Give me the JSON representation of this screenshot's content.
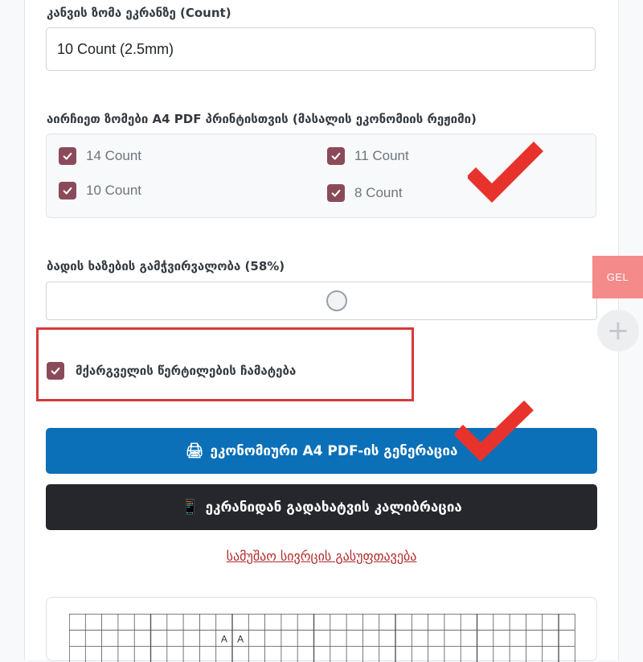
{
  "canvas_size": {
    "label": "კანვის ზომა ეკრანზე (Count)",
    "value": "10 Count (2.5mm)"
  },
  "print_sizes": {
    "label": "აირჩიეთ ზომები A4 PDF პრინტისთვის (მასალის ეკონომიის რეჟიმი)",
    "options": [
      {
        "label": "14 Count",
        "checked": true
      },
      {
        "label": "11 Count",
        "checked": true
      },
      {
        "label": "10 Count",
        "checked": true
      },
      {
        "label": "8 Count",
        "checked": true
      }
    ]
  },
  "grid_opacity": {
    "label": "ბადის ხაზების გამჭვირვალობა (58%)",
    "value": 58
  },
  "marker_dots": {
    "label": "მქარგველის წერტილების ჩამატება",
    "checked": true
  },
  "buttons": {
    "generate_pdf": {
      "icon": "printer-icon",
      "glyph": "🖨",
      "label": "ეკონომიური A4 PDF-ის გენერაცია"
    },
    "calibrate": {
      "icon": "phone-icon",
      "glyph": "📱",
      "label": "ეკრანიდან გადახატვის კალიბრაცია"
    }
  },
  "clear_workspace": "სამუშაო სივრცის გასუფთავება",
  "preview": {
    "cell_letters": [
      "A",
      "A"
    ]
  },
  "currency_badge": "GEL",
  "add_button_glyph": "+",
  "colors": {
    "checkbox": "#8b4a5a",
    "primary_button": "#0b70b8",
    "dark_button": "#25272c",
    "link": "#b12a2a",
    "highlight": "#d63a3a",
    "currency_badge": "#f48a8a"
  }
}
